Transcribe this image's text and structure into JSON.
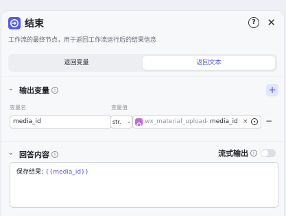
{
  "header": {
    "title": "结束",
    "description": "工作流的最终节点，用于返回工作流运行后的结果信息",
    "help_icon": "question-circle-icon",
    "close_icon": "close-icon",
    "help_glyph": "?",
    "close_glyph": "✕"
  },
  "tabs": [
    {
      "label": "返回变量",
      "selected": false
    },
    {
      "label": "返回文本",
      "selected": true
    }
  ],
  "output_section": {
    "title": "输出变量",
    "info_glyph": "i",
    "add_glyph": "+",
    "column_name": "变量名",
    "column_value": "变量值",
    "rows": [
      {
        "name": "media_id",
        "type": "str.",
        "type_chevron": "⌄",
        "ref_node": "wx_material_upload",
        "ref_separator": "-",
        "ref_variable": "media_id",
        "clear_glyph": "×",
        "remove_glyph": "−"
      }
    ]
  },
  "answer_section": {
    "title": "回答内容",
    "info_glyph": "i",
    "stream_label": "流式输出",
    "stream_enabled": false,
    "content_prefix": "保存结果: ",
    "content_variable": "{{media_id}}"
  },
  "chevron_glyph": "⌄",
  "colors": {
    "accent": "#4e5bf6",
    "node_icon": "#c16bd8"
  }
}
